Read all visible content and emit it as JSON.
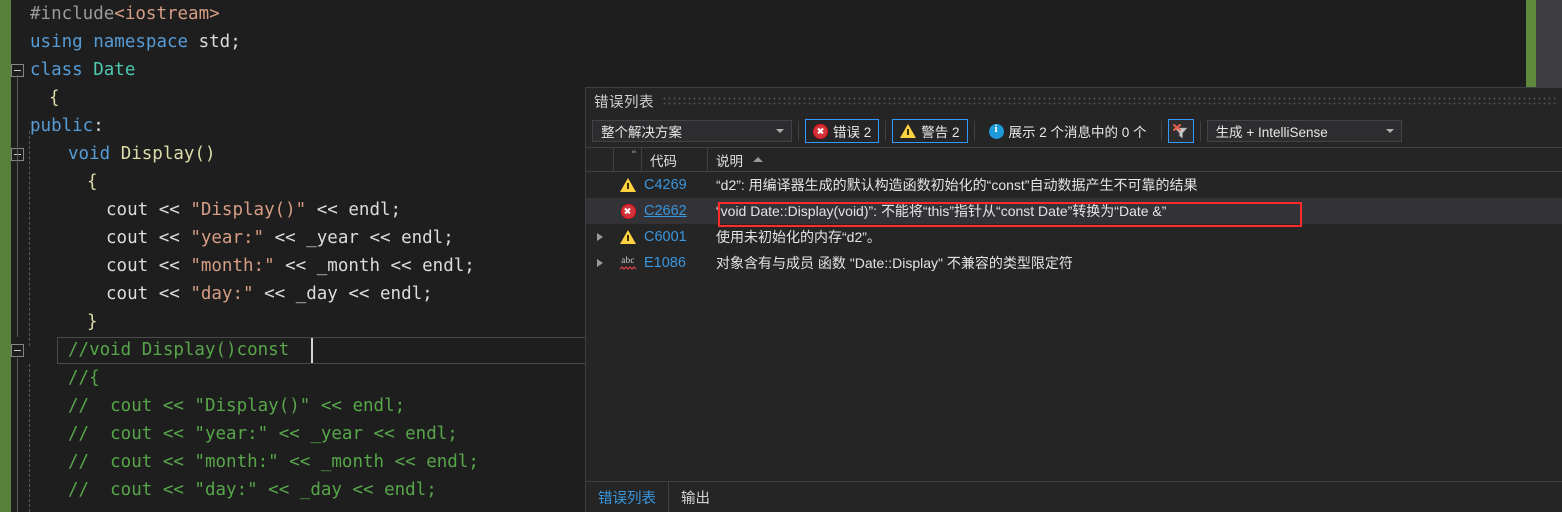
{
  "editor": {
    "lines": [
      {
        "indent": 0,
        "fold": false,
        "tokens": [
          {
            "t": "#include",
            "c": "pp"
          },
          {
            "t": "<iostream>",
            "c": "str"
          }
        ]
      },
      {
        "indent": 0,
        "fold": false,
        "tokens": [
          {
            "t": "using",
            "c": "kw"
          },
          {
            "t": " ",
            "c": "id"
          },
          {
            "t": "namespace",
            "c": "kw"
          },
          {
            "t": " ",
            "c": "id"
          },
          {
            "t": "std;",
            "c": "id"
          }
        ]
      },
      {
        "indent": 0,
        "fold": true,
        "tokens": [
          {
            "t": "class",
            "c": "kw"
          },
          {
            "t": " ",
            "c": "id"
          },
          {
            "t": "Date",
            "c": "kw2"
          }
        ]
      },
      {
        "indent": 1,
        "fold": false,
        "tokens": [
          {
            "t": "{",
            "c": "brace"
          }
        ]
      },
      {
        "indent": 0,
        "fold": false,
        "tokens": [
          {
            "t": "public",
            "c": "kw"
          },
          {
            "t": ":",
            "c": "id"
          }
        ]
      },
      {
        "indent": 2,
        "fold": true,
        "tokens": [
          {
            "t": "void",
            "c": "kw"
          },
          {
            "t": " ",
            "c": "id"
          },
          {
            "t": "Display",
            "c": "pl"
          },
          {
            "t": "()",
            "c": "brace"
          }
        ]
      },
      {
        "indent": 3,
        "fold": false,
        "tokens": [
          {
            "t": "{",
            "c": "brace"
          }
        ]
      },
      {
        "indent": 4,
        "fold": false,
        "tokens": [
          {
            "t": "cout",
            "c": "id"
          },
          {
            "t": " << ",
            "c": "punc"
          },
          {
            "t": "\"Display()\"",
            "c": "str"
          },
          {
            "t": " << ",
            "c": "punc"
          },
          {
            "t": "endl;",
            "c": "id"
          }
        ]
      },
      {
        "indent": 4,
        "fold": false,
        "tokens": [
          {
            "t": "cout",
            "c": "id"
          },
          {
            "t": " << ",
            "c": "punc"
          },
          {
            "t": "\"year:\"",
            "c": "str"
          },
          {
            "t": " << ",
            "c": "punc"
          },
          {
            "t": "_year",
            "c": "id"
          },
          {
            "t": " << ",
            "c": "punc"
          },
          {
            "t": "endl;",
            "c": "id"
          }
        ]
      },
      {
        "indent": 4,
        "fold": false,
        "tokens": [
          {
            "t": "cout",
            "c": "id"
          },
          {
            "t": " << ",
            "c": "punc"
          },
          {
            "t": "\"month:\"",
            "c": "str"
          },
          {
            "t": " << ",
            "c": "punc"
          },
          {
            "t": "_month",
            "c": "id"
          },
          {
            "t": " << ",
            "c": "punc"
          },
          {
            "t": "endl;",
            "c": "id"
          }
        ]
      },
      {
        "indent": 4,
        "fold": false,
        "tokens": [
          {
            "t": "cout",
            "c": "id"
          },
          {
            "t": " << ",
            "c": "punc"
          },
          {
            "t": "\"day:\"",
            "c": "str"
          },
          {
            "t": " << ",
            "c": "punc"
          },
          {
            "t": "_day",
            "c": "id"
          },
          {
            "t": " << ",
            "c": "punc"
          },
          {
            "t": "endl;",
            "c": "id"
          }
        ]
      },
      {
        "indent": 3,
        "fold": false,
        "tokens": [
          {
            "t": "}",
            "c": "brace"
          }
        ]
      },
      {
        "indent": 2,
        "fold": true,
        "tokens": [
          {
            "t": "//void Display()const",
            "c": "com"
          }
        ]
      },
      {
        "indent": 2,
        "fold": false,
        "tokens": [
          {
            "t": "//{",
            "c": "com"
          }
        ]
      },
      {
        "indent": 2,
        "fold": false,
        "tokens": [
          {
            "t": "//  cout << \"Display()\" << endl;",
            "c": "com"
          }
        ]
      },
      {
        "indent": 2,
        "fold": false,
        "tokens": [
          {
            "t": "//  cout << \"year:\" << _year << endl;",
            "c": "com"
          }
        ]
      },
      {
        "indent": 2,
        "fold": false,
        "tokens": [
          {
            "t": "//  cout << \"month:\" << _month << endl;",
            "c": "com"
          }
        ]
      },
      {
        "indent": 2,
        "fold": false,
        "tokens": [
          {
            "t": "//  cout << \"day:\" << _day << endl;",
            "c": "com"
          }
        ]
      }
    ],
    "current_line_index": 12
  },
  "panel": {
    "title": "错误列表",
    "toolbar": {
      "scope_selected": "整个解决方案",
      "errors_label": "错误 2",
      "warnings_label": "警告 2",
      "messages_label": "展示 2 个消息中的 0 个",
      "filter_icon": "clear-filter-icon",
      "build_selected": "生成 + IntelliSense"
    },
    "columns": {
      "code": "代码",
      "description": "说明",
      "sort": "ascending"
    },
    "rows": [
      {
        "expandable": false,
        "severity": "warning",
        "code": "C4269",
        "description": "“d2”: 用编译器生成的默认构造函数初始化的“const”自动数据产生不可靠的结果",
        "selected": false,
        "link": false
      },
      {
        "expandable": false,
        "severity": "error",
        "code": "C2662",
        "description": "“void Date::Display(void)”: 不能将“this”指针从“const Date”转换为“Date &”",
        "selected": true,
        "link": true
      },
      {
        "expandable": true,
        "severity": "warning",
        "code": "C6001",
        "description": "使用未初始化的内存“d2”。",
        "selected": false,
        "link": false
      },
      {
        "expandable": true,
        "severity": "intellisense",
        "code": "E1086",
        "description": "对象含有与成员 函数 \"Date::Display\" 不兼容的类型限定符",
        "selected": false,
        "link": false
      }
    ],
    "annotation": {
      "target_row": 1,
      "color": "#ff2a2a"
    },
    "bottom_tabs": [
      {
        "label": "错误列表",
        "active": true
      },
      {
        "label": "输出",
        "active": false
      }
    ]
  },
  "colors": {
    "editor_bg": "#1e1e1e",
    "panel_bg": "#252526",
    "accent_blue": "#3a96dd",
    "change_bar_green": "#57813b",
    "error_red": "#e81123",
    "warning_yellow": "#ffd23f",
    "annotation_red": "#ff2a2a"
  }
}
